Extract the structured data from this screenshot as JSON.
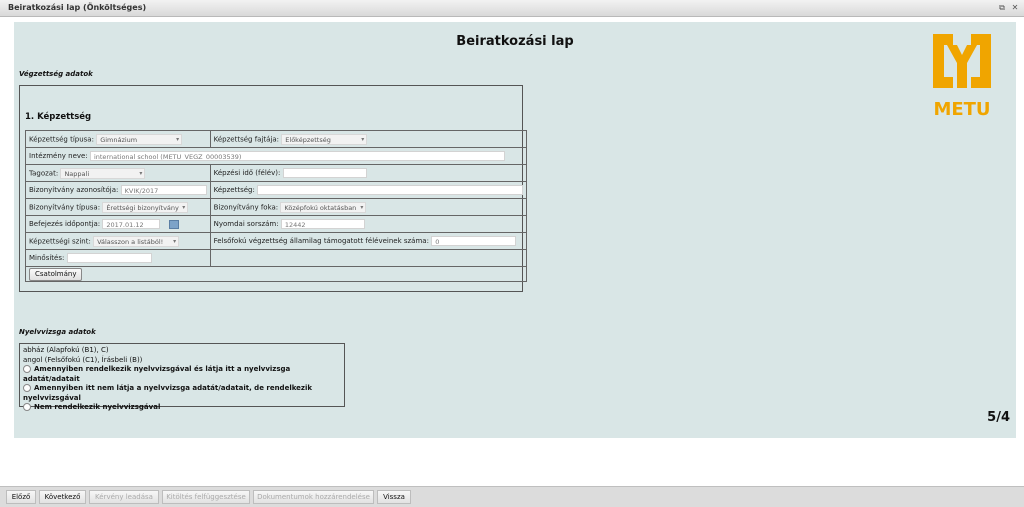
{
  "window": {
    "title": "Beiratkozási lap (Önköltséges)"
  },
  "page": {
    "heading": "Beiratkozási lap",
    "page_indicator": "5/4"
  },
  "logo": {
    "text": "METU",
    "color": "#f0a500"
  },
  "education": {
    "section_title": "Végzettség adatok",
    "subtitle": "1. Képzettség",
    "fields": {
      "qual_type_label": "Képzettség típusa:",
      "qual_type_value": "Gimnázium",
      "qual_kind_label": "Képzettség fajtája:",
      "qual_kind_value": "Előképzettség",
      "institution_label": "Intézmény neve:",
      "institution_value": "international school (METU_VEGZ_00003539)",
      "mode_label": "Tagozat:",
      "mode_value": "Nappali",
      "duration_label": "Képzési idő (félév):",
      "duration_value": "",
      "cert_id_label": "Bizonyítvány azonosítója:",
      "cert_id_value": "KVIK/2017",
      "qualification_label": "Képzettség:",
      "qualification_value": "",
      "cert_type_label": "Bizonyítvány típusa:",
      "cert_type_value": "Érettségi bizonyítvány",
      "cert_level_label": "Bizonyítvány foka:",
      "cert_level_value": "Középfokú oktatásban",
      "completion_label": "Befejezés időpontja:",
      "completion_value": "2017.01.12",
      "print_no_label": "Nyomdai sorszám:",
      "print_no_value": "12442",
      "qual_level_label": "Képzettségi szint:",
      "qual_level_value": "Válasszon a listából!",
      "semesters_label": "Felsőfokú végzettség államilag támogatott féléveinek száma:",
      "semesters_value": "0",
      "grade_label": "Minősítés:",
      "grade_value": ""
    },
    "attachment_button": "Csatolmány"
  },
  "language": {
    "section_title": "Nyelvvizsga adatok",
    "exams": [
      "abház (Alapfokú (B1), C)",
      "angol (Felsőfokú (C1), Írásbeli (B))"
    ],
    "options": [
      "Amennyiben rendelkezik nyelvvizsgával és látja itt a nyelvvizsga adatát/adatait",
      "Amennyiben itt nem látja a nyelvvizsga adatát/adatait, de rendelkezik nyelvvizsgával",
      "Nem rendelkezik nyelvvizsgával"
    ]
  },
  "nav": {
    "prev": "Előző",
    "next": "Következő",
    "submit": "Kérvény leadása",
    "suspend": "Kitöltés felfüggesztése",
    "attach_docs": "Dokumentumok hozzárendelése",
    "back": "Vissza"
  }
}
